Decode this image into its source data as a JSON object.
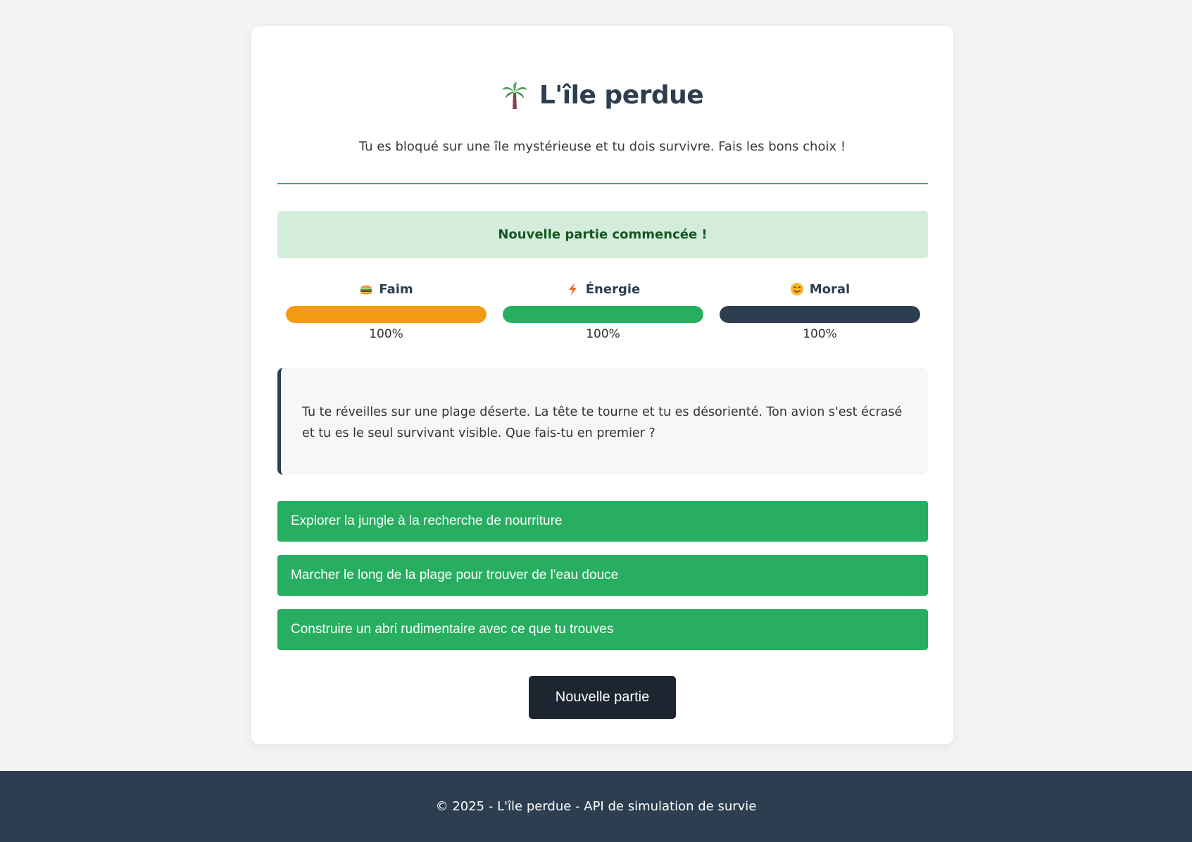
{
  "header": {
    "title": "L'île perdue",
    "title_icon": "palm-tree-icon",
    "subtitle": "Tu es bloqué sur une île mystérieuse et tu dois survivre. Fais les bons choix !"
  },
  "status": {
    "message": "Nouvelle partie commencée !"
  },
  "stats": [
    {
      "label": "Faim",
      "icon": "burger-icon",
      "value_text": "100%",
      "value": 100,
      "color": "#f39c12"
    },
    {
      "label": "Énergie",
      "icon": "lightning-icon",
      "value_text": "100%",
      "value": 100,
      "color": "#27ae60"
    },
    {
      "label": "Moral",
      "icon": "smiley-icon",
      "value_text": "100%",
      "value": 100,
      "color": "#2c3e50"
    }
  ],
  "story": {
    "text": "Tu te réveilles sur une plage déserte. La tête te tourne et tu es désorienté. Ton avion s'est écrasé et tu es le seul survivant visible. Que fais-tu en premier ?"
  },
  "choices": [
    "Explorer la jungle à la recherche de nourriture",
    "Marcher le long de la plage pour trouver de l'eau douce",
    "Construire un abri rudimentaire avec ce que tu trouves"
  ],
  "actions": {
    "new_game_label": "Nouvelle partie"
  },
  "footer": {
    "text": "© 2025 - L'île perdue - API de simulation de survie"
  },
  "colors": {
    "primary": "#2c3e50",
    "success": "#27ae60",
    "warning": "#f39c12",
    "banner_bg": "#d4edda",
    "banner_text": "#155724"
  }
}
